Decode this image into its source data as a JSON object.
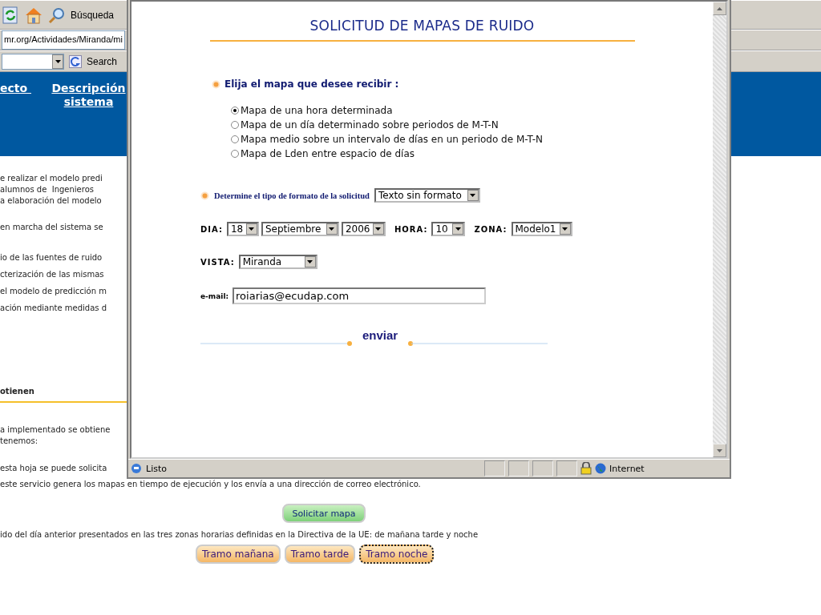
{
  "browser": {
    "search_label": "Búsqueda",
    "address": "mr.org/Actividades/Miranda/mi",
    "google_search_label": "Search"
  },
  "banner": {
    "links": [
      "ecto ",
      "Descripción sistema"
    ]
  },
  "page": {
    "intro": [
      "e realizar el modelo predi",
      "alumnos de  Ingenieros ",
      "a elaboración del modelo "
    ],
    "start_line": "en marcha del sistema se",
    "steps": [
      "io de las fuentes de ruido",
      "cterización de las mismas",
      "el modelo de predicción m",
      "ación mediante medidas d"
    ],
    "heading": "otienen",
    "result": [
      "a implementado se obtiene",
      "tenemos:"
    ],
    "service": [
      "esta hoja se puede solicita",
      "este servicio genera los mapas en tiempo de ejecución y los envía a una dirección de correo electrónico."
    ],
    "request_button": "Solicitar mapa",
    "zones_text": "ido del día anterior presentados en las tres zonas horarias definidas en la Directiva de la UE: de mañana tarde y noche",
    "zone_buttons": [
      {
        "label": "Tramo mañana",
        "focused": false
      },
      {
        "label": "Tramo tarde",
        "focused": false
      },
      {
        "label": "Tramo noche",
        "focused": true
      }
    ]
  },
  "popup": {
    "title": "SOLICITUD DE MAPAS DE RUIDO",
    "map_question": "Elija el mapa que desee recibir :",
    "map_options": [
      {
        "label": "Mapa de una hora determinada",
        "selected": true
      },
      {
        "label": "Mapa de un día determinado sobre periodos de M-T-N",
        "selected": false
      },
      {
        "label": "Mapa medio sobre un intervalo de días en un periodo de M-T-N",
        "selected": false
      },
      {
        "label": "Mapa de Lden entre espacio de días",
        "selected": false
      }
    ],
    "format_label": "Determine el tipo de formato de la solicitud",
    "format_value": "Texto sin formato",
    "day_label": "DIA:",
    "day": "18",
    "month": "Septiembre",
    "year": "2006",
    "hour_label": "HORA:",
    "hour": "10",
    "zone_label": "ZONA:",
    "zone": "Modelo1",
    "view_label": "VISTA:",
    "view": "Miranda",
    "email_label": "e-mail:",
    "email": "roiarias@ecudap.com",
    "send": "enviar",
    "status": "Listo",
    "zone_status": "Internet"
  }
}
